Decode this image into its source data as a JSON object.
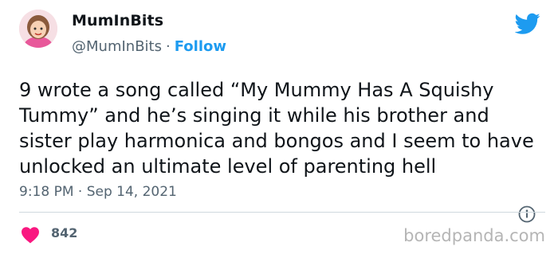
{
  "author": {
    "display_name": "MumInBits",
    "handle": "@MumInBits",
    "separator": "·",
    "follow_label": "Follow"
  },
  "tweet": {
    "text": "9 wrote a song called “My Mummy Has A Squishy Tummy” and he’s singing it while his brother and sister play harmonica and bongos and I seem to have unlocked an ultimate level of parenting hell",
    "timestamp": "9:18 PM · Sep 14, 2021"
  },
  "engagement": {
    "likes": "842"
  },
  "watermark": "boredpanda.com",
  "colors": {
    "accent": "#1d9bf0",
    "like": "#f91880",
    "muted": "#536471",
    "divider": "#cfd9de"
  },
  "icons": {
    "brand": "twitter-bird-icon",
    "info": "info-icon",
    "like": "heart-icon"
  }
}
